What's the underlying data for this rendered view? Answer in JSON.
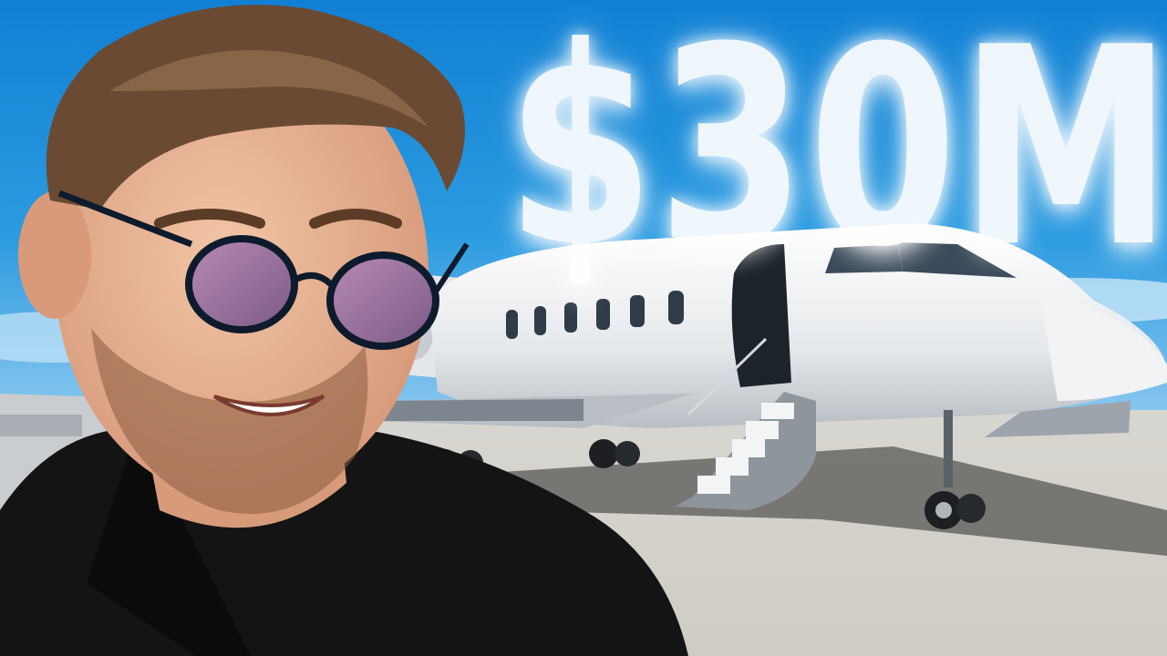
{
  "thumbnail": {
    "headline": "$30M"
  },
  "scene": {
    "sky_color": "#1e8fd8",
    "tarmac_color": "#dcd9d2",
    "jet_color": "#eef0f2",
    "shirt_color": "#141414",
    "lens_color": "#9c6f9a"
  }
}
